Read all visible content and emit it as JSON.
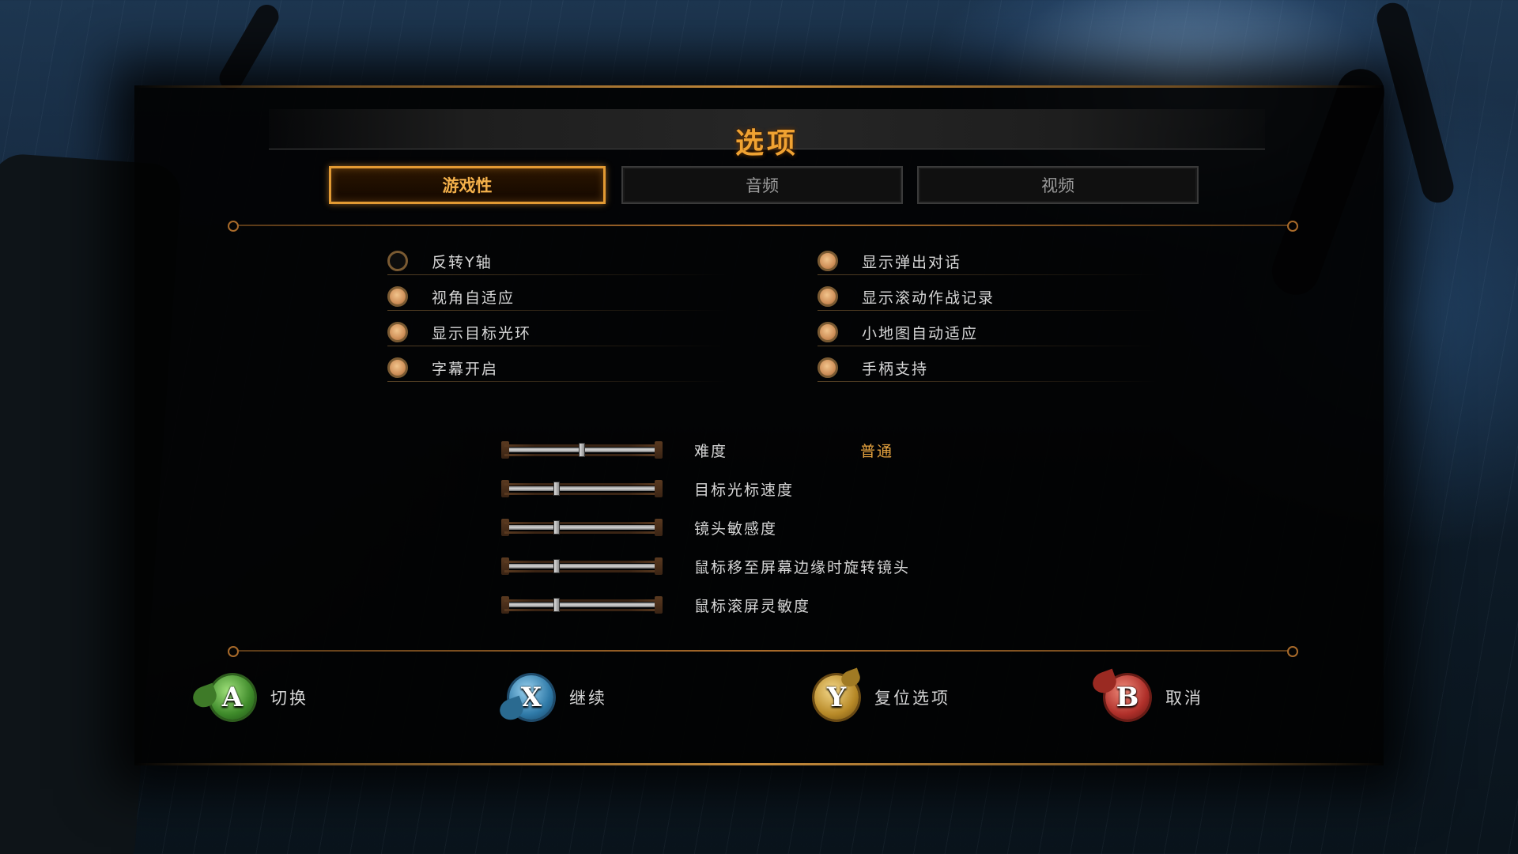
{
  "title": "选项",
  "tabs": [
    {
      "label": "游戏性",
      "active": true
    },
    {
      "label": "音频",
      "active": false
    },
    {
      "label": "视频",
      "active": false
    }
  ],
  "toggles_left": [
    {
      "label": "反转Y轴",
      "on": false
    },
    {
      "label": "视角自适应",
      "on": true
    },
    {
      "label": "显示目标光环",
      "on": true
    },
    {
      "label": "字幕开启",
      "on": true
    }
  ],
  "toggles_right": [
    {
      "label": "显示弹出对话",
      "on": true
    },
    {
      "label": "显示滚动作战记录",
      "on": true
    },
    {
      "label": "小地图自动适应",
      "on": true
    },
    {
      "label": "手柄支持",
      "on": true
    }
  ],
  "sliders": [
    {
      "label": "难度",
      "value_text": "普通",
      "level": 0.5
    },
    {
      "label": "目标光标速度",
      "value_text": "",
      "level": 0.33
    },
    {
      "label": "镜头敏感度",
      "value_text": "",
      "level": 0.33
    },
    {
      "label": "鼠标移至屏幕边缘时旋转镜头",
      "value_text": "",
      "level": 0.33
    },
    {
      "label": "鼠标滚屏灵敏度",
      "value_text": "",
      "level": 0.33
    }
  ],
  "button_hints": [
    {
      "button": "A",
      "label": "切换",
      "icon": "a-button-icon"
    },
    {
      "button": "X",
      "label": "继续",
      "icon": "x-button-icon"
    },
    {
      "button": "Y",
      "label": "复位选项",
      "icon": "y-button-icon"
    },
    {
      "button": "B",
      "label": "取消",
      "icon": "b-button-icon"
    }
  ],
  "colors": {
    "accent": "#f0a232",
    "toggle_on": "#d0915a",
    "text": "#d6d6d6"
  }
}
